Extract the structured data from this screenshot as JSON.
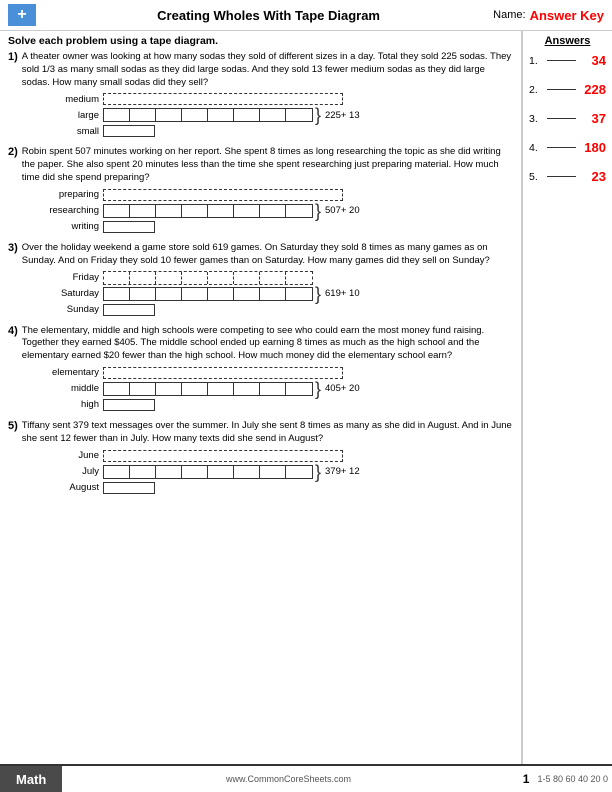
{
  "header": {
    "title": "Creating Wholes With Tape Diagram",
    "name_label": "Name:",
    "answer_key": "Answer Key",
    "logo_symbol": "+"
  },
  "instructions": "Solve each problem using a tape diagram.",
  "answers": {
    "title": "Answers",
    "items": [
      {
        "num": "1.",
        "value": "34"
      },
      {
        "num": "2.",
        "value": "228"
      },
      {
        "num": "3.",
        "value": "37"
      },
      {
        "num": "4.",
        "value": "180"
      },
      {
        "num": "5.",
        "value": "23"
      }
    ]
  },
  "problems": [
    {
      "num": "1)",
      "text": "A theater owner was looking at how many sodas they sold of different sizes in a day. Total they sold 225 sodas. They sold 1/3 as many small sodas as they did large sodas. And they sold 13 fewer medium sodas as they did large sodas. How many small sodas did they sell?",
      "diagram": {
        "rows": [
          {
            "label": "medium",
            "type": "wide-dashed"
          },
          {
            "label": "large",
            "type": "segments-8",
            "brace": "225+ 13"
          },
          {
            "label": "small",
            "type": "single"
          }
        ]
      }
    },
    {
      "num": "2)",
      "text": "Robin spent 507 minutes working on her report. She spent 8 times as long researching the topic as she did writing the paper. She also spent 20 minutes less than the time she spent researching just preparing material. How much time did she spend preparing?",
      "diagram": {
        "rows": [
          {
            "label": "preparing",
            "type": "wide-dashed"
          },
          {
            "label": "researching",
            "type": "segments-8",
            "brace": "507+ 20"
          },
          {
            "label": "writing",
            "type": "single"
          }
        ]
      }
    },
    {
      "num": "3)",
      "text": "Over the holiday weekend a game store sold 619 games. On Saturday they sold 8 times as many games as on Sunday. And on Friday they sold 10 fewer games than on Saturday. How many games did they sell on Sunday?",
      "diagram": {
        "rows": [
          {
            "label": "Friday",
            "type": "segments-8-dashed"
          },
          {
            "label": "Saturday",
            "type": "segments-8",
            "brace": "619+ 10"
          },
          {
            "label": "Sunday",
            "type": "single"
          }
        ]
      }
    },
    {
      "num": "4)",
      "text": "The elementary, middle and high schools were competing to see who could earn the most money fund raising. Together they earned $405. The middle school ended up earning 8 times as much as the high school and the elementary earned $20 fewer than the high school. How much money did the elementary school earn?",
      "diagram": {
        "rows": [
          {
            "label": "elementary",
            "type": "wide-dashed"
          },
          {
            "label": "middle",
            "type": "segments-8",
            "brace": "405+ 20"
          },
          {
            "label": "high",
            "type": "single"
          }
        ]
      }
    },
    {
      "num": "5)",
      "text": "Tiffany sent 379 text messages over the summer. In July she sent 8 times as many as she did in August. And in June she sent 12 fewer than in July. How many texts did she send in August?",
      "diagram": {
        "rows": [
          {
            "label": "June",
            "type": "wide-dashed"
          },
          {
            "label": "July",
            "type": "segments-8",
            "brace": "379+ 12"
          },
          {
            "label": "August",
            "type": "single"
          }
        ]
      }
    }
  ],
  "footer": {
    "math_label": "Math",
    "url": "www.CommonCoreSheets.com",
    "page": "1",
    "scores": "1-5  80 60 40 20  0"
  }
}
